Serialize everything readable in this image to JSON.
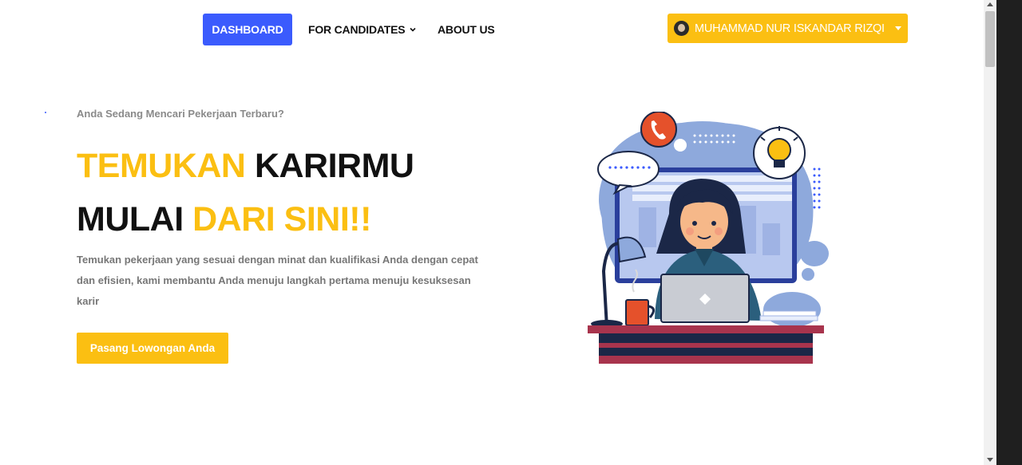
{
  "nav": {
    "dashboard_label": "DASHBOARD",
    "candidates_label": "FOR CANDIDATES",
    "about_label": "ABOUT US"
  },
  "user": {
    "name": "MUHAMMAD NUR ISKANDAR RIZQI"
  },
  "hero": {
    "eyebrow": "Anda Sedang Mencari Pekerjaan Terbaru?",
    "line1_accent": "TEMUKAN",
    "line1_rest": "KARIRMU",
    "line2_start": "MULAI",
    "line2_accent": "DARI SINI!!",
    "description": "Temukan pekerjaan yang sesuai dengan minat dan kualifikasi Anda dengan cepat dan efisien, kami membantu Anda menuju langkah pertama menuju kesuksesan karir",
    "cta_label": "Pasang Lowongan Anda"
  },
  "colors": {
    "primary_blue": "#3b5bfd",
    "accent_yellow": "#fbbf12"
  },
  "icons": [
    "chevron-down-icon",
    "avatar",
    "caret-down-icon",
    "phone-icon",
    "lightbulb-icon"
  ]
}
